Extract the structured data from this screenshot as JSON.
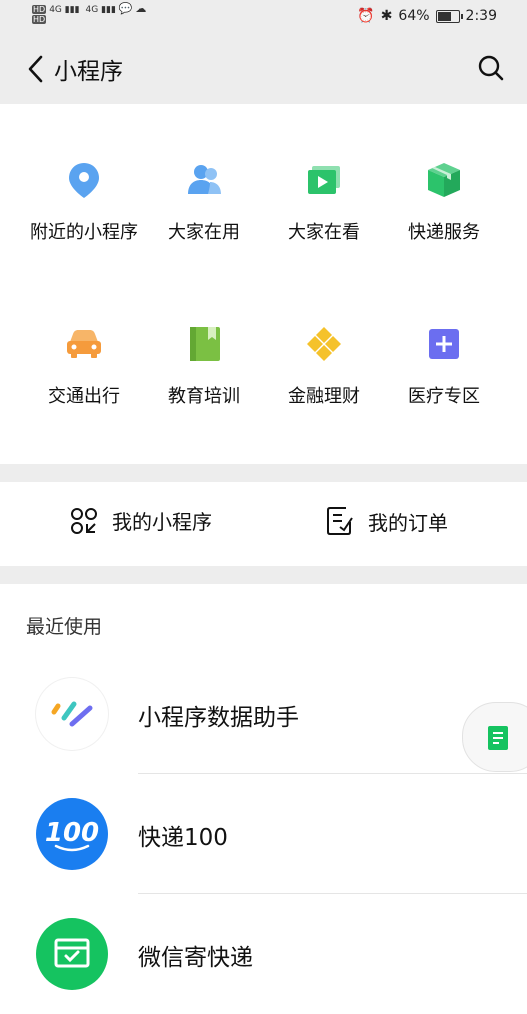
{
  "status_bar": {
    "left_badge_1": "HD",
    "left_badge_2": "HD",
    "network_1": "4G",
    "network_2": "4G",
    "battery_text": "64%",
    "time": "2:39"
  },
  "nav": {
    "title": "小程序"
  },
  "grid": [
    {
      "label": "附近的小程序",
      "icon": "location-pin-icon",
      "color": "#5aa3f0"
    },
    {
      "label": "大家在用",
      "icon": "people-icon",
      "color": "#5aa3f0"
    },
    {
      "label": "大家在看",
      "icon": "video-icon",
      "color": "#2cc36b"
    },
    {
      "label": "快递服务",
      "icon": "package-icon",
      "color": "#2cc36b"
    },
    {
      "label": "交通出行",
      "icon": "car-icon",
      "color": "#f59b3c"
    },
    {
      "label": "教育培训",
      "icon": "book-icon",
      "color": "#7bc043"
    },
    {
      "label": "金融理财",
      "icon": "diamond-icon",
      "color": "#f5c22b"
    },
    {
      "label": "医疗专区",
      "icon": "medical-plus-icon",
      "color": "#6b6ef0"
    }
  ],
  "mine": {
    "my_miniprograms": "我的小程序",
    "my_orders": "我的订单"
  },
  "recent": {
    "header": "最近使用",
    "items": [
      {
        "name": "小程序数据助手",
        "icon": "data-assistant-logo-icon"
      },
      {
        "name": "快递100",
        "icon": "kuaidi100-logo-icon",
        "logo_text": "100"
      },
      {
        "name": "微信寄快递",
        "icon": "wechat-express-logo-icon"
      }
    ]
  }
}
